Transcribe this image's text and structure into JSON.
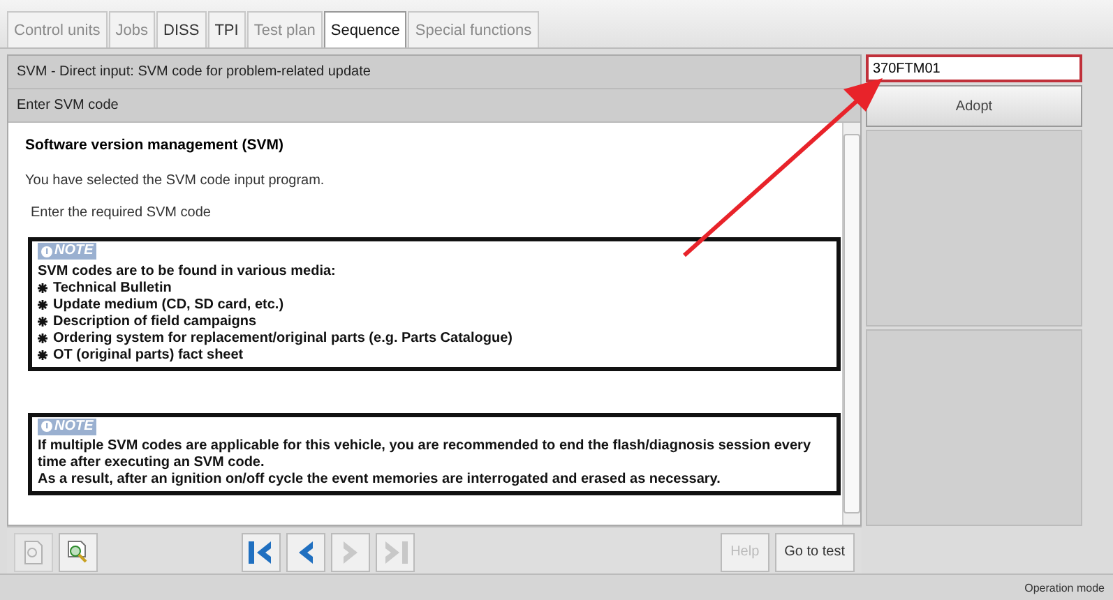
{
  "tabs": [
    {
      "label": "Control units",
      "selected": false,
      "disabled": true
    },
    {
      "label": "Jobs",
      "selected": false,
      "disabled": true
    },
    {
      "label": "DISS",
      "selected": false,
      "disabled": false
    },
    {
      "label": "TPI",
      "selected": false,
      "disabled": false
    },
    {
      "label": "Test plan",
      "selected": false,
      "disabled": true
    },
    {
      "label": "Sequence",
      "selected": true,
      "disabled": false
    },
    {
      "label": "Special functions",
      "selected": false,
      "disabled": true
    }
  ],
  "header": {
    "title": "SVM - Direct input: SVM code for problem-related update",
    "subtitle": "Enter SVM code"
  },
  "code_field": {
    "value": "370FTM01"
  },
  "adopt_button": {
    "label": "Adopt"
  },
  "content": {
    "heading": "Software version management (SVM)",
    "paragraphs": [
      "You have selected the SVM code input program.",
      "Enter the required SVM code"
    ],
    "notes": [
      {
        "label": "NOTE",
        "lines": [
          {
            "kind": "text",
            "text": "SVM codes are to be found in various media:"
          },
          {
            "kind": "bullet",
            "text": "Technical Bulletin"
          },
          {
            "kind": "bullet",
            "text": "Update medium (CD, SD card, etc.)"
          },
          {
            "kind": "bullet",
            "text": "Description of field campaigns"
          },
          {
            "kind": "bullet",
            "text": "Ordering system for replacement/original parts (e.g. Parts Catalogue)"
          },
          {
            "kind": "bullet",
            "text": "OT (original parts) fact sheet"
          }
        ]
      },
      {
        "label": "NOTE",
        "lines": [
          {
            "kind": "text",
            "text": "If multiple SVM codes are applicable for this vehicle, you are recommended to end the flash/diagnosis session every time after executing an SVM code."
          },
          {
            "kind": "text",
            "text": "As a result, after an ignition on/off cycle the event memories are interrogated and erased as necessary."
          }
        ]
      }
    ]
  },
  "toolbar": {
    "tools": [
      {
        "kind": "document",
        "disabled": true
      },
      {
        "kind": "zoom",
        "disabled": false
      }
    ],
    "nav": [
      {
        "kind": "first",
        "disabled": false
      },
      {
        "kind": "previous",
        "disabled": false
      },
      {
        "kind": "next",
        "disabled": true
      },
      {
        "kind": "last",
        "disabled": true
      }
    ],
    "buttons": [
      {
        "label": "Help",
        "disabled": true
      },
      {
        "label": "Go to test",
        "disabled": false
      }
    ]
  },
  "status_bar": {
    "text": "Operation mode"
  }
}
